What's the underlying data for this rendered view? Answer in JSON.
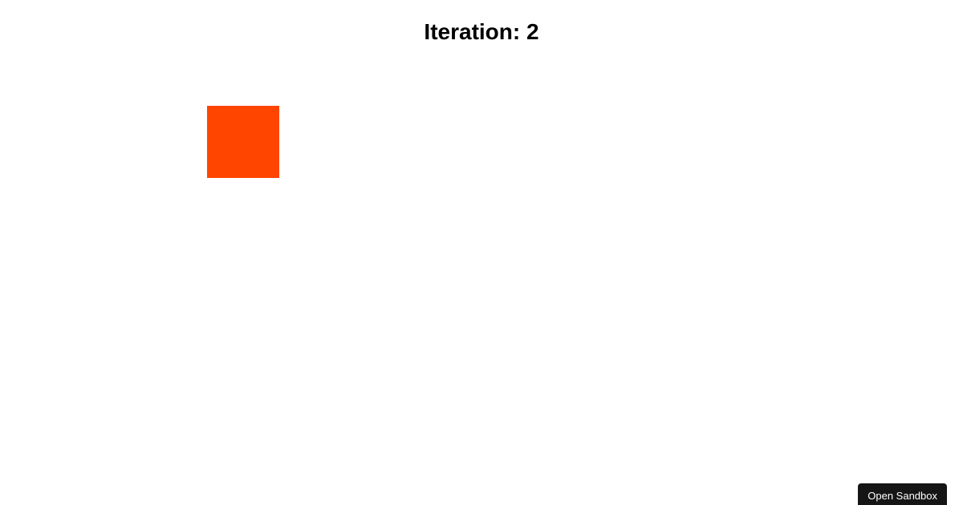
{
  "heading": {
    "prefix": "Iteration: ",
    "value": 2
  },
  "box": {
    "color": "#ff4500"
  },
  "footer": {
    "sandbox_button_label": "Open Sandbox"
  }
}
